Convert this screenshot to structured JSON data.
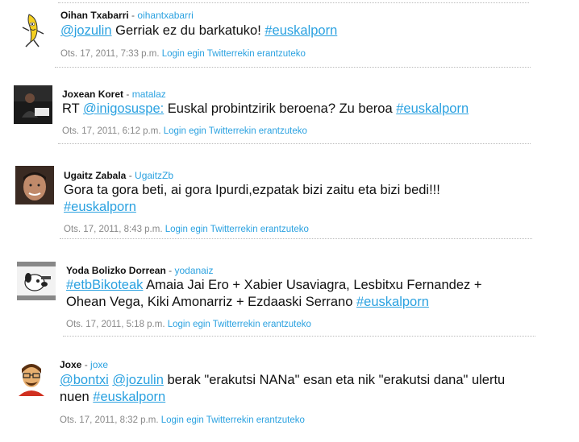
{
  "tweets": [
    {
      "author": "Oihan Txabarri",
      "handle": "oihantxabarri",
      "text": {
        "m1": "@jozulin",
        "t1": " Gerriak ez du barkatuko! ",
        "h1": "#euskalporn"
      },
      "date": "Ots. 17, 2011, 7:33 p.m.",
      "login": "Login egin Twitterrekin erantzuteko",
      "avatar_icon": "banana-icon"
    },
    {
      "author": "Joxean Koret",
      "handle": "matalaz",
      "text": {
        "t0": "RT ",
        "m1": "@inigosuspe:",
        "t1": " Euskal probintzirik beroena? Zu beroa ",
        "h1": "#euskalporn"
      },
      "date": "Ots. 17, 2011, 6:12 p.m.",
      "login": "Login egin Twitterrekin erantzuteko",
      "avatar_icon": "person-photo-icon"
    },
    {
      "author": "Ugaitz Zabala",
      "handle": "UgaitzZb",
      "text": {
        "t0": "Gora ta gora beti, ai gora Ipurdi,ezpatak bizi zaitu eta bizi bedi!!!",
        "h1": "#euskalporn"
      },
      "date": "Ots. 17, 2011, 8:43 p.m.",
      "login": "Login egin Twitterrekin erantzuteko",
      "avatar_icon": "face-photo-icon"
    },
    {
      "author": "Yoda Bolizko Dorrean",
      "handle": "yodanaiz",
      "text": {
        "h0": "#etbBikoteak",
        "t1": " Amaia Jai Ero + Xabier Usaviagra, Lesbitxu Fernandez + Ohean Vega, Kiki Amonarriz + Ezdaaski Serrano ",
        "h1": "#euskalporn"
      },
      "date": "Ots. 17, 2011, 5:18 p.m.",
      "login": "Login egin Twitterrekin erantzuteko",
      "avatar_icon": "cartoon-dog-icon"
    },
    {
      "author": "Joxe",
      "handle": "joxe",
      "text": {
        "m1": "@bontxi",
        "s1": " ",
        "m2": "@jozulin",
        "t1": " berak \"erakutsi NANa\" esan eta nik \"erakutsi dana\" ulertu nuen ",
        "h1": "#euskalporn"
      },
      "date": "Ots. 17, 2011, 8:32 p.m.",
      "login": "Login egin Twitterrekin erantzuteko",
      "avatar_icon": "cartoon-man-icon"
    }
  ]
}
